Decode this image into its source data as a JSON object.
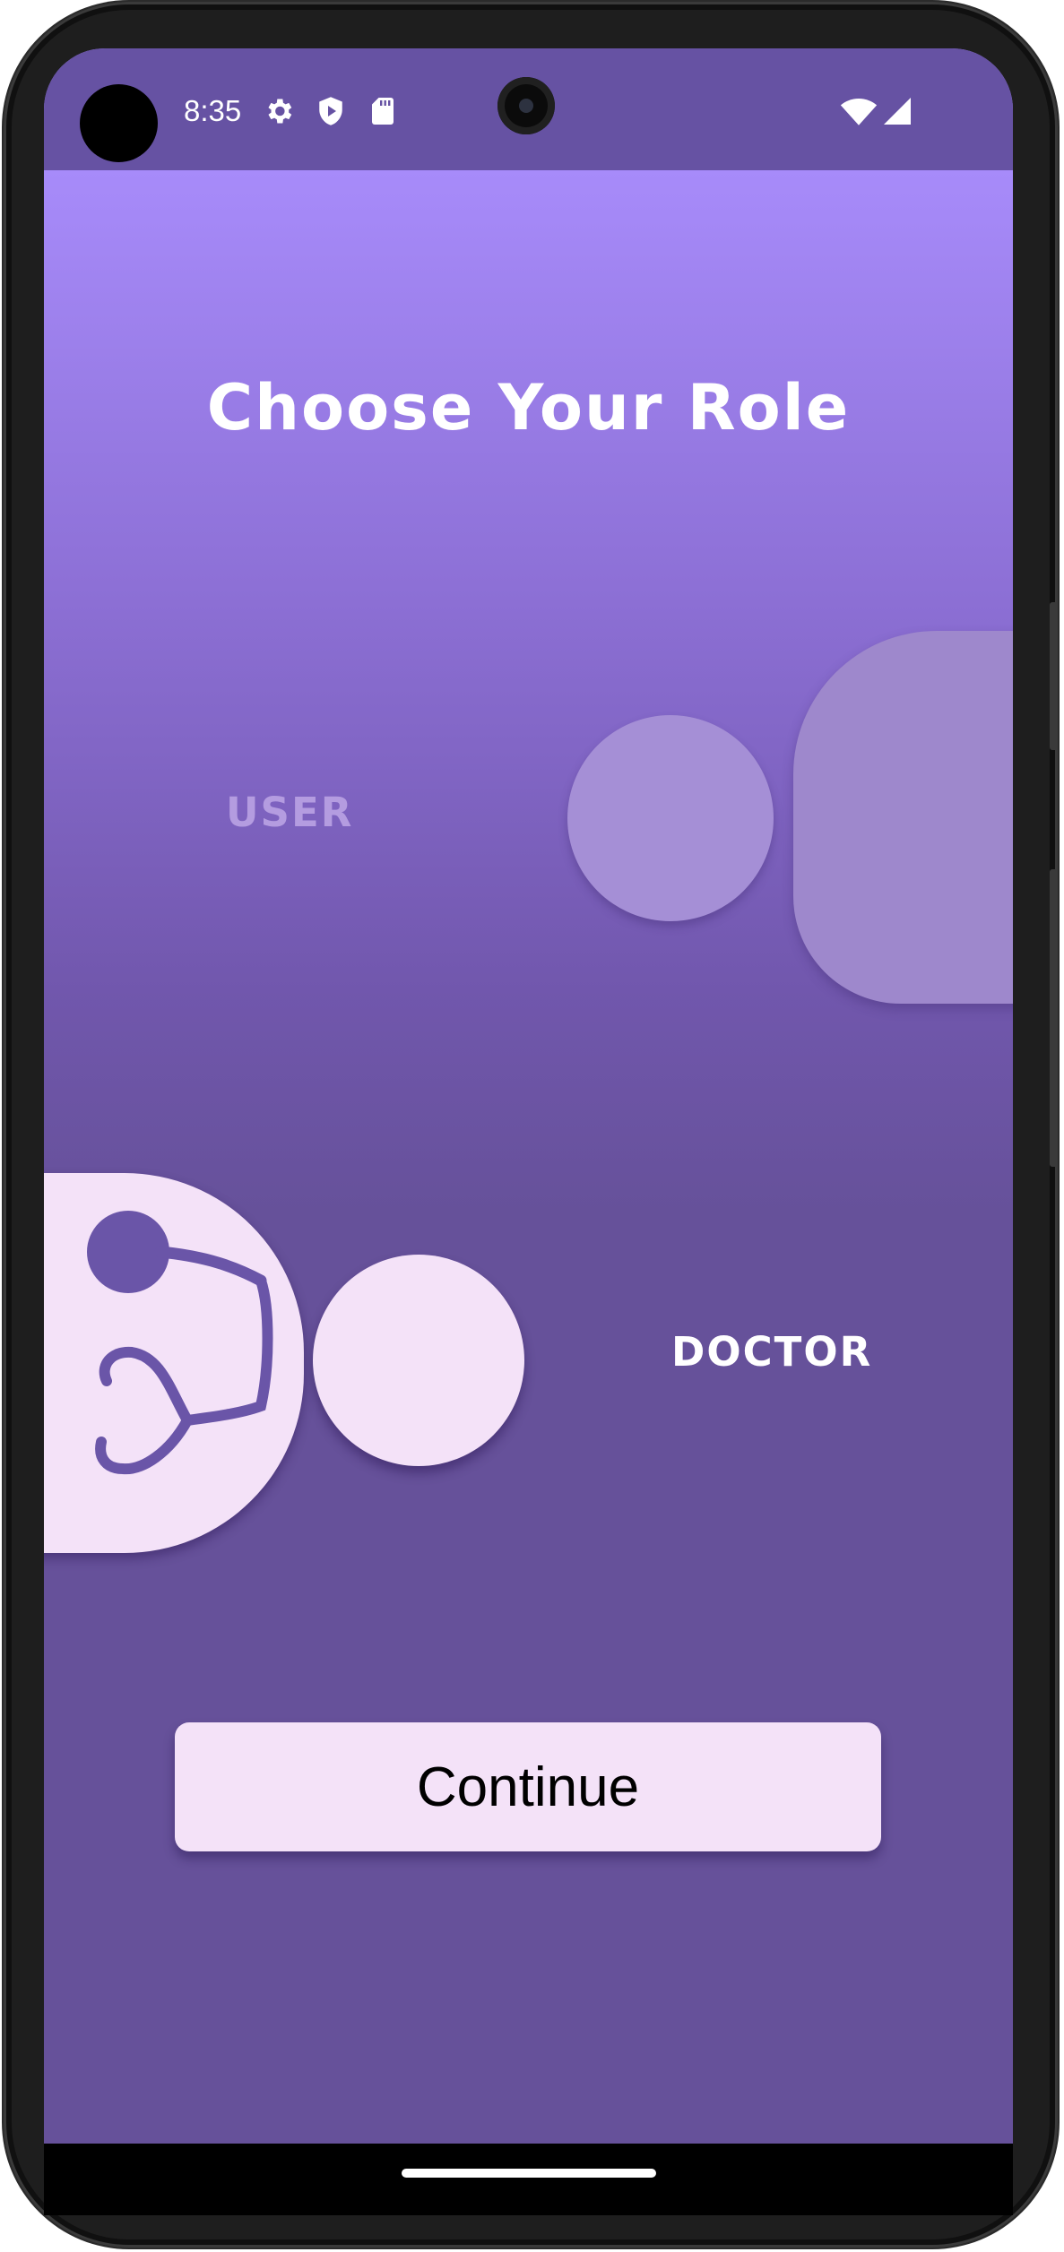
{
  "status_bar": {
    "time": "8:35",
    "icons": [
      "settings-icon",
      "shield-play-icon",
      "sd-card-icon",
      "wifi-icon",
      "cell-signal-icon"
    ]
  },
  "screen": {
    "title": "Choose Your Role",
    "roles": [
      {
        "label": "USER",
        "selected": false
      },
      {
        "label": "DOCTOR",
        "selected": true
      }
    ],
    "continue_label": "Continue"
  },
  "colors": {
    "status_bar_bg": "#6652a3",
    "gradient_top": "#a78bfa",
    "gradient_bottom": "#66519a",
    "selected_shape": "#f4e2f8",
    "unselected_shape": "#a58fd6",
    "stethoscope": "#6a55a8"
  }
}
